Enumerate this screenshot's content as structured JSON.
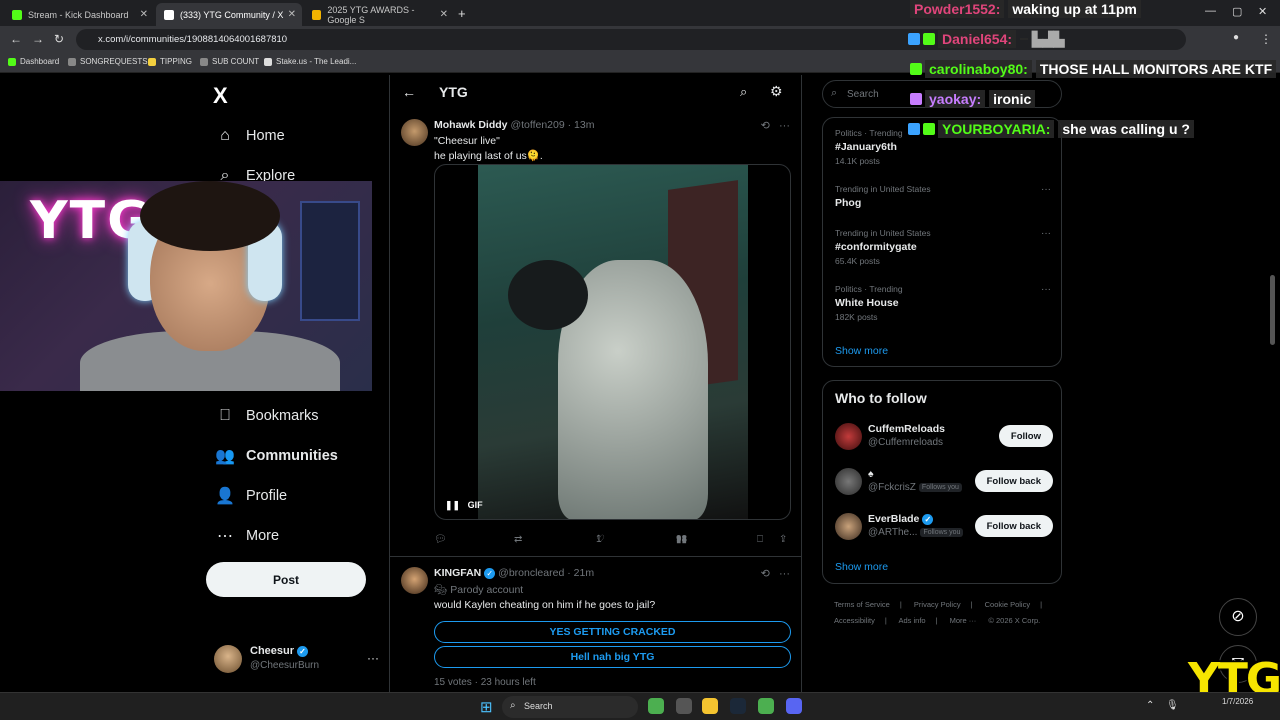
{
  "browser": {
    "tabs": [
      {
        "title": "Stream - Kick Dashboard",
        "color": "#53fc18"
      },
      {
        "title": "(333) YTG Community / X",
        "color": "#ffffff"
      },
      {
        "title": "2025 YTG AWARDS - Google S",
        "color": "#f4b400"
      }
    ],
    "url": "x.com/i/communities/1908814064001687810",
    "bookmarks": [
      {
        "label": "Dashboard",
        "color": "#53fc18"
      },
      {
        "label": "SONGREQUESTS",
        "color": "#888888"
      },
      {
        "label": "TIPPING",
        "color": "#f4d03f"
      },
      {
        "label": "SUB COUNT",
        "color": "#888888"
      },
      {
        "label": "Stake.us - The Leadi...",
        "color": "#dddddd"
      }
    ]
  },
  "nav": {
    "logo": "X",
    "items": [
      {
        "label": "Home",
        "icon": "home-icon",
        "glyph": "⌂"
      },
      {
        "label": "Explore",
        "icon": "search-icon",
        "glyph": "⌕"
      },
      {
        "label": "Bookmarks",
        "icon": "bookmark-icon",
        "glyph": "⎕"
      },
      {
        "label": "Communities",
        "icon": "communities-icon",
        "glyph": "👥"
      },
      {
        "label": "Profile",
        "icon": "person-icon",
        "glyph": "👤"
      },
      {
        "label": "More",
        "icon": "more-circle-icon",
        "glyph": "⋯"
      }
    ],
    "post_label": "Post",
    "account": {
      "name": "Cheesur",
      "handle": "@CheesurBurn"
    }
  },
  "webcam": {
    "sign": "YTG"
  },
  "main": {
    "title": "YTG",
    "posts": [
      {
        "name": "Mohawk Diddy",
        "handle": "@toffen209",
        "time": "13m",
        "lines": [
          "\"Cheesur live\"",
          " he playing last of us🫠."
        ],
        "media_label": "GIF",
        "actions": {
          "replies": "",
          "reposts": "",
          "likes": "1",
          "views": "98"
        }
      },
      {
        "name": "KINGFAN",
        "handle": "@broncleared",
        "time": "21m",
        "parody": "Parody account",
        "text": "would Kaylen cheating on him if he goes to jail?",
        "poll": [
          "YES GETTING CRACKED",
          "Hell nah big YTG"
        ],
        "poll_meta": "15 votes · 23 hours left"
      }
    ]
  },
  "right": {
    "search_placeholder": "Search",
    "trends": [
      {
        "context": "Politics · Trending",
        "name": "#January6th",
        "count": "14.1K posts"
      },
      {
        "context": "Trending in United States",
        "name": "Phog",
        "count": ""
      },
      {
        "context": "Trending in United States",
        "name": "#conformitygate",
        "count": "65.4K posts"
      },
      {
        "context": "Politics · Trending",
        "name": "White House",
        "count": "182K posts"
      }
    ],
    "show_more": "Show more",
    "who_to_follow": {
      "title": "Who to follow",
      "accounts": [
        {
          "name": "CuffemReloads",
          "handle": "@Cuffemreloads",
          "follows_you": "",
          "button": "Follow",
          "verified": false
        },
        {
          "name": "",
          "handle": "@FckcrisZ",
          "follows_you": "Follows you",
          "button": "Follow back",
          "verified": false
        },
        {
          "name": "EverBlade",
          "handle": "@ARThe...",
          "follows_you": "Follows you",
          "button": "Follow back",
          "verified": true
        }
      ],
      "show_more": "Show more"
    },
    "footer": [
      "Terms of Service",
      "|",
      "Privacy Policy",
      "|",
      "Cookie Policy",
      "|",
      "Accessibility",
      "|",
      "Ads info",
      "|",
      "More ···",
      "© 2026 X Corp."
    ]
  },
  "chat": [
    {
      "user": "Powder1552:",
      "user_color": "#e0457b",
      "msg": "waking up at 11pm"
    },
    {
      "user": "Daniel654:",
      "user_color": "#e0457b",
      "msg": ""
    },
    {
      "user": "carolinaboy80:",
      "user_color": "#53fc18",
      "msg": "THOSE HALL MONITORS ARE KTF"
    },
    {
      "user": "yaokay:",
      "user_color": "#c77dff",
      "msg": "ironic"
    },
    {
      "user": "YOURBOYARIA:",
      "user_color": "#53fc18",
      "msg": "she was calling u ?"
    }
  ],
  "overlay_logo": "YTG",
  "taskbar": {
    "search_label": "Search",
    "date": "1/7/2026"
  }
}
